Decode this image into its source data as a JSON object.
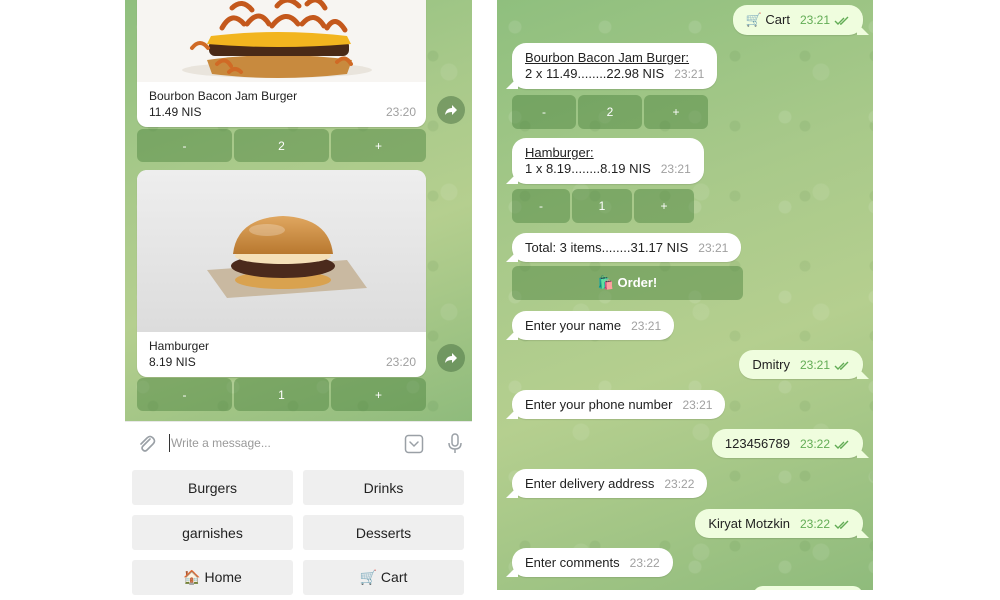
{
  "left": {
    "items": [
      {
        "name": "Bourbon Bacon Jam Burger",
        "price": "11.49 NIS",
        "time": "23:20",
        "qty": "2"
      },
      {
        "name": "Hamburger",
        "price": "8.19 NIS",
        "time": "23:20",
        "qty": "1"
      }
    ],
    "kb_minus": "-",
    "kb_plus": "+",
    "input_placeholder": "Write a message...",
    "reply_keyboard": {
      "burgers": "Burgers",
      "drinks": "Drinks",
      "garnishes": "garnishes",
      "desserts": "Desserts",
      "home": "🏠 Home",
      "cart": "🛒 Cart"
    }
  },
  "right": {
    "cart_msg": {
      "text": "🛒 Cart",
      "time": "23:21"
    },
    "item1": {
      "title": "Bourbon Bacon Jam Burger:",
      "line": "2 x 11.49........22.98 NIS",
      "time": "23:21",
      "qty": "2"
    },
    "item2": {
      "title": "Hamburger:",
      "line": "1 x 8.19........8.19 NIS",
      "time": "23:21",
      "qty": "1"
    },
    "total": {
      "text": "Total: 3 items........31.17 NIS",
      "time": "23:21"
    },
    "order_button": "🛍️ Order!",
    "minus": "-",
    "plus": "+",
    "conversation": [
      {
        "dir": "in",
        "text": "Enter your name",
        "time": "23:21"
      },
      {
        "dir": "out",
        "text": "Dmitry",
        "time": "23:21"
      },
      {
        "dir": "in",
        "text": "Enter your phone number",
        "time": "23:21"
      },
      {
        "dir": "out",
        "text": "123456789",
        "time": "23:22"
      },
      {
        "dir": "in",
        "text": "Enter delivery address",
        "time": "23:22"
      },
      {
        "dir": "out",
        "text": "Kiryat Motzkin",
        "time": "23:22"
      },
      {
        "dir": "in",
        "text": "Enter comments",
        "time": "23:22"
      }
    ]
  },
  "colors": {
    "chat_bg": "#a8c98a",
    "inline_button": "#6a9a5c",
    "outgoing_bubble": "#effdde",
    "read_check": "#62ac55"
  }
}
